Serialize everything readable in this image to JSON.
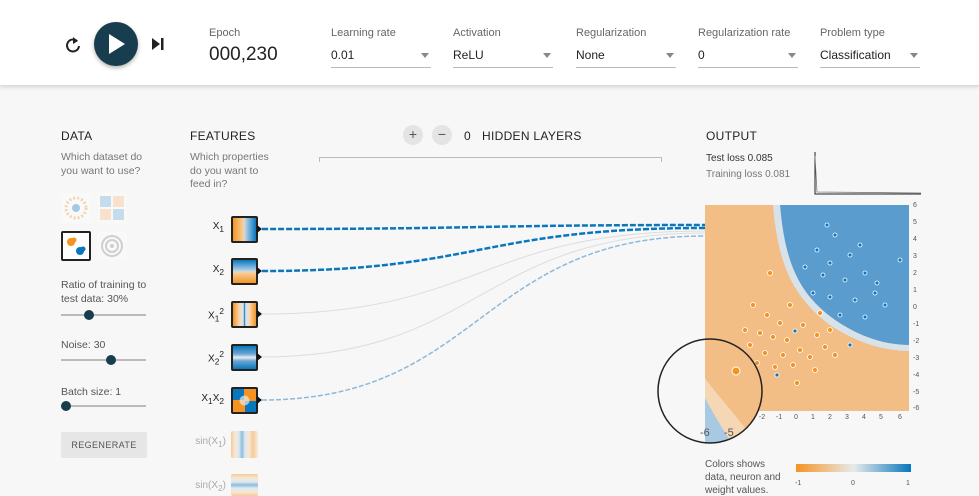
{
  "toolbar": {
    "epoch_label": "Epoch",
    "epoch_value": "000,230",
    "learning_rate": {
      "label": "Learning rate",
      "value": "0.01"
    },
    "activation": {
      "label": "Activation",
      "value": "ReLU"
    },
    "regularization": {
      "label": "Regularization",
      "value": "None"
    },
    "regularization_rate": {
      "label": "Regularization rate",
      "value": "0"
    },
    "problem_type": {
      "label": "Problem type",
      "value": "Classification"
    },
    "icons": [
      "reset-icon",
      "play-icon",
      "step-forward-icon"
    ]
  },
  "data_panel": {
    "heading": "DATA",
    "subtitle": "Which dataset do you want to use?",
    "datasets": [
      "circle",
      "xor",
      "gaussian",
      "spiral"
    ],
    "selected_dataset": "gaussian",
    "ratio_label": "Ratio of training to test data:",
    "ratio_value": "30%",
    "ratio_fraction": 0.3,
    "noise_label": "Noise:",
    "noise_value": "30",
    "noise_fraction": 0.6,
    "batch_label": "Batch size:",
    "batch_value": "1",
    "batch_fraction": 0.0,
    "regenerate_label": "REGENERATE"
  },
  "features": {
    "heading": "FEATURES",
    "subtitle": "Which properties do you want to feed in?",
    "items": [
      {
        "name": "X",
        "sub": "1",
        "sup": "",
        "active": true
      },
      {
        "name": "X",
        "sub": "2",
        "sup": "",
        "active": true
      },
      {
        "name": "X",
        "sub": "1",
        "sup": "2",
        "active": true
      },
      {
        "name": "X",
        "sub": "2",
        "sup": "2",
        "active": true
      },
      {
        "name": "X",
        "sub": "1",
        "sup": "",
        "name2": "X",
        "sub2": "2",
        "active": true
      },
      {
        "name": "sin(X",
        "sub": "1",
        "sup": "",
        "close": ")",
        "active": false
      },
      {
        "name": "sin(X",
        "sub": "2",
        "sup": "",
        "close": ")",
        "active": false
      }
    ]
  },
  "hidden_layers": {
    "plus": "+",
    "minus": "−",
    "count": "0",
    "label": "HIDDEN LAYERS"
  },
  "output": {
    "heading": "OUTPUT",
    "test_loss": "Test loss 0.085",
    "training_loss": "Training loss 0.081",
    "y_ticks": [
      "6",
      "5",
      "4",
      "3",
      "2",
      "1",
      "0",
      "-1",
      "-2",
      "-3",
      "-4",
      "-5",
      "-6"
    ],
    "x_ticks": [
      "-6",
      "-5",
      "-4",
      "-3",
      "-2",
      "-1",
      "0",
      "1",
      "2",
      "3",
      "4",
      "5",
      "6"
    ],
    "zoom_x_ticks": [
      "-6",
      "-5"
    ],
    "legend_text": "Colors shows data, neuron and weight values.",
    "legend_ticks": [
      "-1",
      "0",
      "1"
    ],
    "colors": {
      "orange": "#f59322",
      "blue": "#0877bd",
      "dark": "#183d4e"
    }
  }
}
